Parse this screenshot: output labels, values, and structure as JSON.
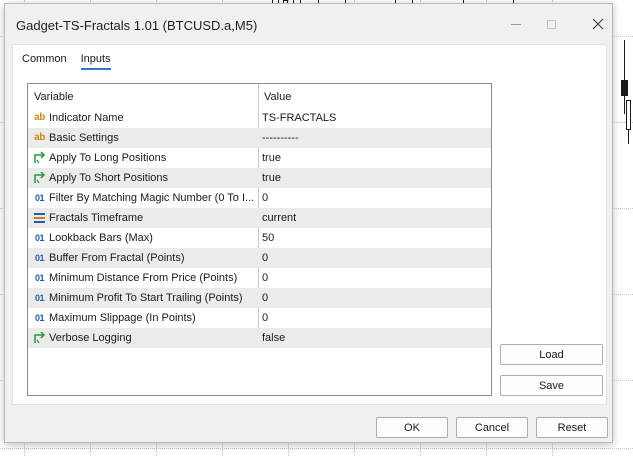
{
  "dialog": {
    "title": "Gadget-TS-Fractals 1.01 (BTCUSD.a,M5)"
  },
  "tabs": [
    "Common",
    "Inputs"
  ],
  "grid": {
    "header": {
      "variable": "Variable",
      "value": "Value"
    },
    "rows": [
      {
        "icon": "ab",
        "name": "Indicator Name",
        "value": "TS-FRACTALS"
      },
      {
        "icon": "ab",
        "name": "Basic Settings",
        "value": "----------"
      },
      {
        "icon": "bool",
        "name": "Apply To Long Positions",
        "value": "true"
      },
      {
        "icon": "bool",
        "name": "Apply To Short Positions",
        "value": "true"
      },
      {
        "icon": "01",
        "name": "Filter By Matching Magic Number (0 To I...",
        "value": "0"
      },
      {
        "icon": "enum",
        "name": "Fractals Timeframe",
        "value": "current"
      },
      {
        "icon": "01",
        "name": "Lookback Bars (Max)",
        "value": "50"
      },
      {
        "icon": "01",
        "name": "Buffer From Fractal (Points)",
        "value": "0"
      },
      {
        "icon": "01",
        "name": "Minimum Distance From Price (Points)",
        "value": "0"
      },
      {
        "icon": "01",
        "name": "Minimum Profit To Start Trailing (Points)",
        "value": "0"
      },
      {
        "icon": "01",
        "name": "Maximum Slippage (In Points)",
        "value": "0"
      },
      {
        "icon": "bool",
        "name": "Verbose Logging",
        "value": "false"
      }
    ]
  },
  "buttons": {
    "load": "Load",
    "save": "Save",
    "ok": "OK",
    "cancel": "Cancel",
    "reset": "Reset"
  },
  "icons": {
    "ab": "string-param-icon",
    "01": "integer-param-icon",
    "bool": "bool-param-icon",
    "enum": "enum-param-icon"
  }
}
